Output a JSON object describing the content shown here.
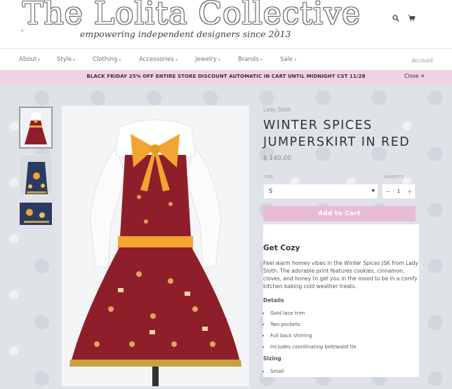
{
  "header": {
    "logo_title": "The Lolita Collective",
    "logo_tagline": "empowering independent designers since 2013",
    "icons": [
      "search-icon",
      "cart-icon"
    ]
  },
  "nav": {
    "items": [
      {
        "label": "About"
      },
      {
        "label": "Style"
      },
      {
        "label": "Clothing"
      },
      {
        "label": "Accessories"
      },
      {
        "label": "Jewelry"
      },
      {
        "label": "Brands"
      },
      {
        "label": "Sale"
      }
    ],
    "account": "Account"
  },
  "banner": {
    "text": "BLACK FRIDAY 25% OFF ENTIRE STORE DISCOUNT AUTOMATIC IN CART UNTIL MIDNIGHT CST 11/28",
    "close_label": "Close"
  },
  "product": {
    "vendor": "Lady Sloth",
    "title": "WINTER SPICES JUMPERSKIRT IN RED",
    "price": "$ 140.00",
    "size_label": "SIZE",
    "size_value": "S",
    "quantity_label": "QUANTITY",
    "quantity_value": "1",
    "qty_minus": "−",
    "qty_plus": "+",
    "add_to_cart": "Add to Cart"
  },
  "description": {
    "heading": "Get Cozy",
    "body": "Feel warm homey vibes in the Winter Spices JSK from Lady Sloth. The adorable print features cookies, cinnamon, cloves, and honey to get you in the mood to be in a comfy kitchen baking cold weather treats.",
    "details_heading": "Details",
    "details": [
      "Gold lace trim",
      "Two pockets",
      "Full back shirring",
      "Includes coordinating belt/waist tie"
    ],
    "sizing_heading": "Sizing",
    "sizing": [
      "Small"
    ]
  },
  "colors": {
    "accent_pink": "#e8bcd5",
    "banner_pink": "#efd3e4",
    "dress_red": "#8e1e2a",
    "bow_orange": "#f2a531"
  }
}
